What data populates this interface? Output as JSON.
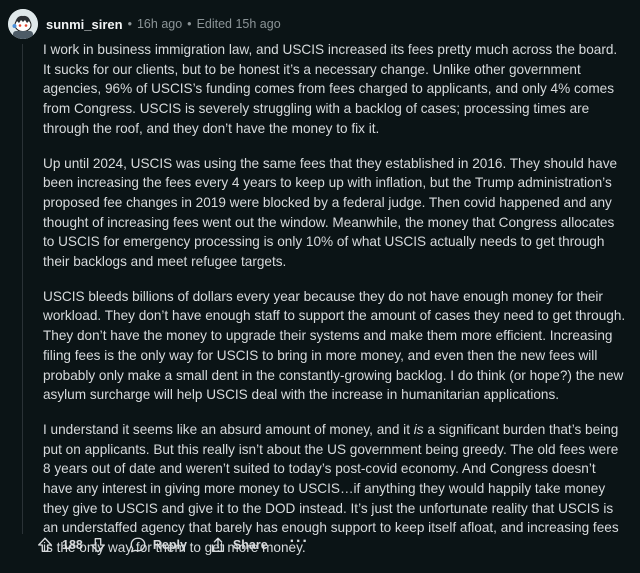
{
  "comment": {
    "author": "sunmi_siren",
    "separator": "•",
    "time": "16h ago",
    "edited": "Edited 15h ago",
    "paragraphs": [
      "I work in business immigration law, and USCIS increased its fees pretty much across the board. It sucks for our clients, but to be honest it’s a necessary change. Unlike other government agencies, 96% of USCIS’s funding comes from fees charged to applicants, and only 4% comes from Congress. USCIS is severely struggling with a backlog of cases; processing times are through the roof, and they don’t have the money to fix it.",
      "Up until 2024, USCIS was using the same fees that they established in 2016. They should have been increasing the fees every 4 years to keep up with inflation, but the Trump administration’s proposed fee changes in 2019 were blocked by a federal judge. Then covid happened and any thought of increasing fees went out the window. Meanwhile, the money that Congress allocates to USCIS for emergency processing is only 10% of what USCIS actually needs to get through their backlogs and meet refugee targets.",
      "USCIS bleeds billions of dollars every year because they do not have enough money for their workload. They don’t have enough staff to support the amount of cases they need to get through. They don’t have the money to upgrade their systems and make them more efficient. Increasing filing fees is the only way for USCIS to bring in more money, and even then the new fees will probably only make a small dent in the constantly-growing backlog. I do think (or hope?) the new asylum surcharge will help USCIS deal with the increase in humanitarian applications."
    ],
    "p4_before": "I understand it seems like an absurd amount of money, and it ",
    "p4_emph": "is",
    "p4_after": " a significant burden that’s being put on applicants. But this really isn’t about the US government being greedy. The old fees were 8 years out of date and weren’t suited to today’s post-covid economy. And Congress doesn’t have any interest in giving more money to USCIS…if anything they would happily take money they give to USCIS and give it to the DOD instead. It’s just the unfortunate reality that USCIS is an understaffed agency that barely has enough support to keep itself afloat, and increasing fees is the only way for them to get more money."
  },
  "actions": {
    "votes": "188",
    "reply_label": "Reply",
    "share_label": "Share",
    "more_label": "···"
  },
  "icons": {
    "avatar": "snoo-avatar-icon",
    "upvote": "upvote-arrow-icon",
    "downvote": "downvote-arrow-icon",
    "reply": "comment-bubble-icon",
    "share": "share-icon"
  },
  "colors": {
    "background": "#0b1416",
    "text": "#d7dadc",
    "muted": "#8b9497"
  }
}
